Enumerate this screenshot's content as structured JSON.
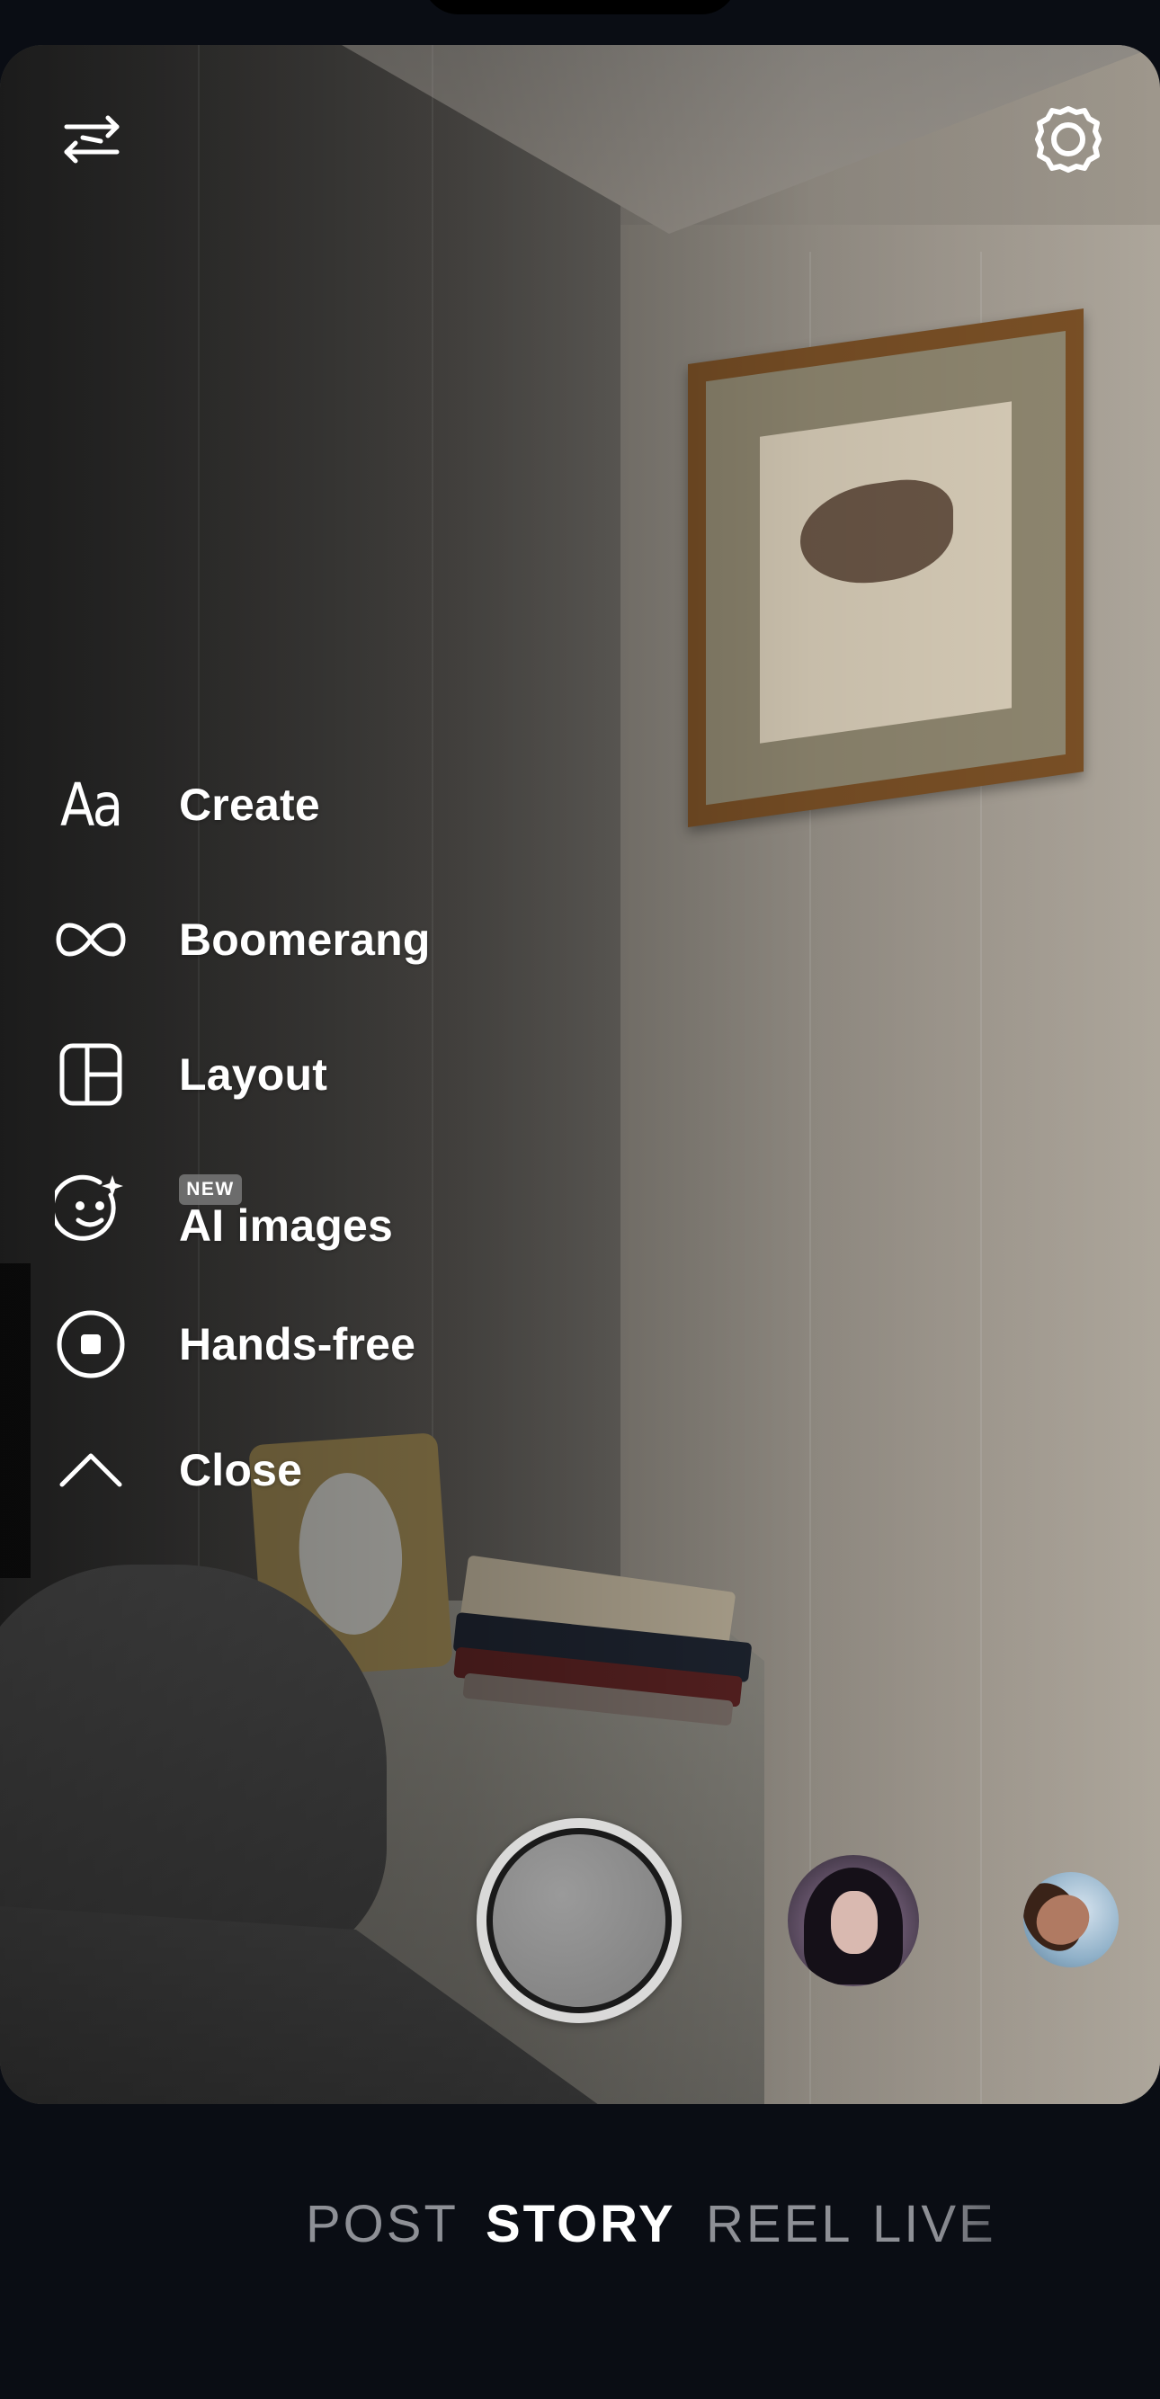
{
  "top_bar": {
    "flip_icon": "switch-camera-icon",
    "settings_icon": "gear-icon"
  },
  "menu": {
    "items": [
      {
        "label": "Create",
        "icon": "text-aa-icon"
      },
      {
        "label": "Boomerang",
        "icon": "infinity-icon"
      },
      {
        "label": "Layout",
        "icon": "layout-grid-icon"
      },
      {
        "label": "AI images",
        "icon": "sparkle-face-icon",
        "badge": "NEW"
      },
      {
        "label": "Hands-free",
        "icon": "record-stop-icon"
      },
      {
        "label": "Close",
        "icon": "chevron-up-icon"
      }
    ]
  },
  "modes": {
    "items": [
      "POST",
      "STORY",
      "REEL",
      "LIVE"
    ],
    "selected": "STORY"
  },
  "colors": {
    "background": "#0a0d14",
    "text_active": "#ffffff",
    "text_inactive": "#8e9096"
  }
}
